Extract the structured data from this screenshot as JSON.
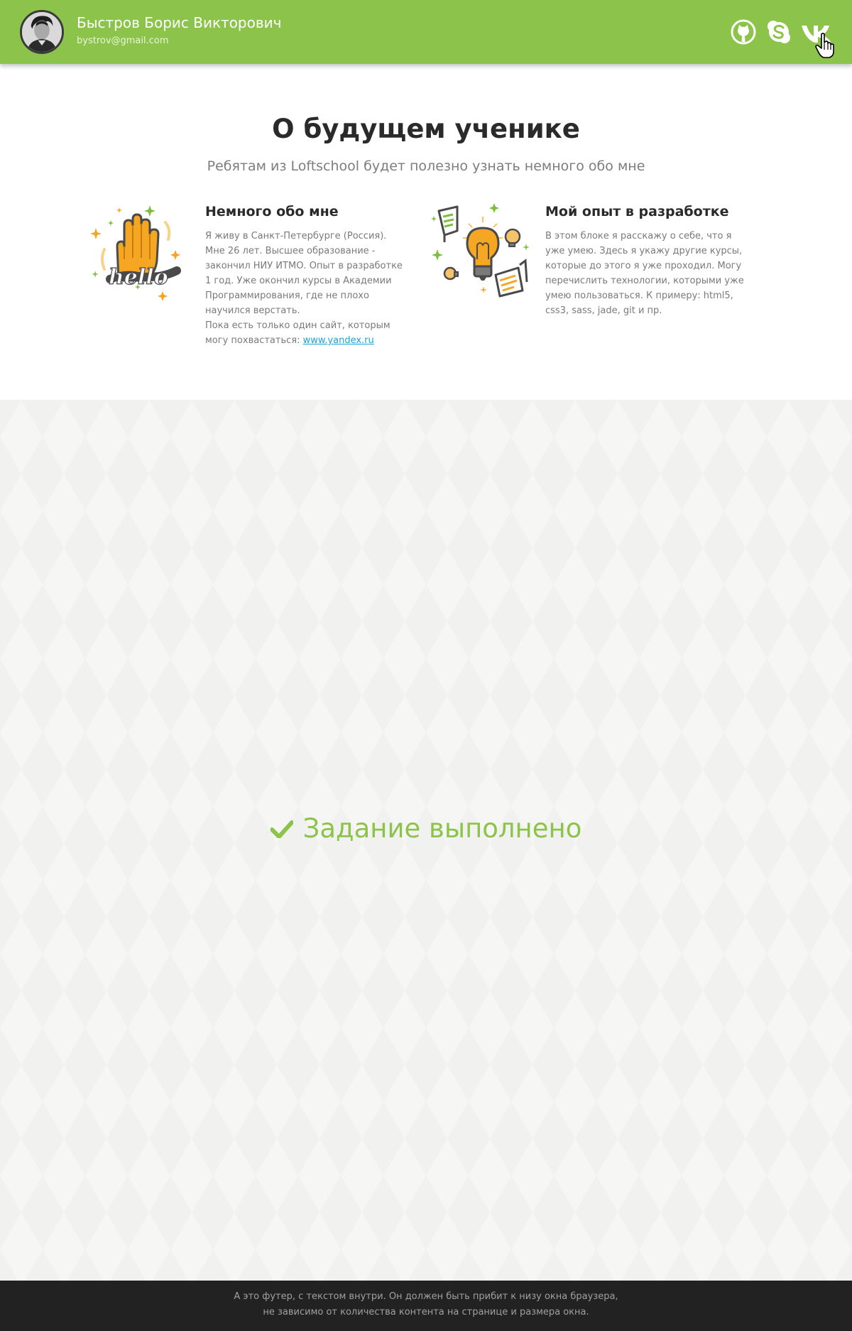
{
  "header": {
    "user_name": "Быстров Борис Викторович",
    "user_email": "bystrov@gmail.com",
    "avatar_icon": "user-photo",
    "social": [
      {
        "name": "github",
        "icon": "github-icon"
      },
      {
        "name": "skype",
        "icon": "skype-icon"
      },
      {
        "name": "vk",
        "icon": "vk-icon"
      }
    ],
    "accent_color": "#8cc34a"
  },
  "about": {
    "title": "О будущем ученике",
    "subtitle": "Ребятам из Loftschool будет полезно узнать немного обо мне",
    "blocks": [
      {
        "icon": "hello-hand-icon",
        "title": "Немного обо мне",
        "text": "Я живу в Санкт-Петербурге (Россия). Мне 26 лет. Высшее образование - закончил НИУ ИТМО. Опыт в разработке 1 год. Уже окончил курсы в Академии Программирования, где не плохо научился верстать.",
        "text2": "Пока есть только один сайт, которым могу похвастаться: ",
        "link": "www.yandex.ru"
      },
      {
        "icon": "lightbulb-icon",
        "title": "Мой опыт в разработке",
        "text": "В этом блоке я расскажу о себе, что я уже умею. Здесь я укажу другие курсы, которые до этого я уже проходил. Могу перечислить технологии, которыми уже умею пользоваться. К примеру: html5, css3, sass, jade, git и пр."
      }
    ]
  },
  "main": {
    "status_text": "Задание выполнено",
    "status_icon": "checkmark-icon",
    "status_color": "#8cc34a"
  },
  "footer": {
    "line1": "А это футер, с текстом внутри. Он должен быть прибит к низу окна браузера,",
    "line2": "не зависимо от количества контента на странице и размера окна."
  }
}
